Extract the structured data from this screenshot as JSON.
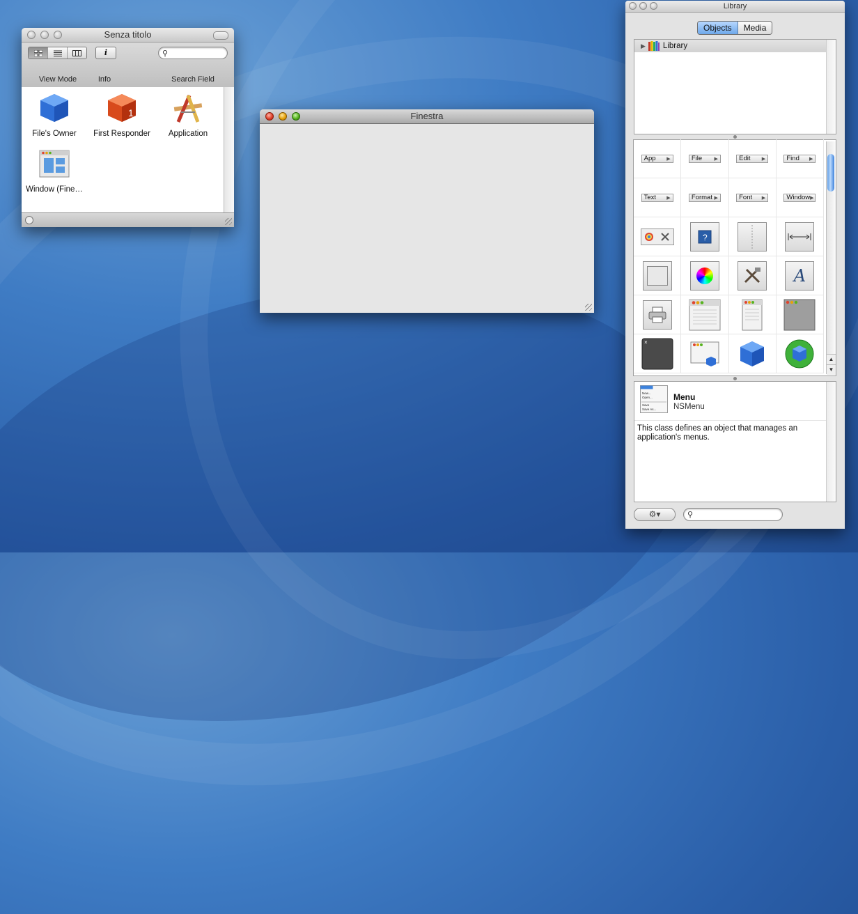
{
  "doc_window": {
    "title": "Senza titolo",
    "toolbar": {
      "view_mode_label": "View Mode",
      "info_label": "Info",
      "info_glyph": "i",
      "search_label": "Search Field",
      "search_value": ""
    },
    "items": [
      {
        "label": "File's Owner",
        "icon": "blue-cube-icon"
      },
      {
        "label": "First Responder",
        "icon": "red-cube-icon"
      },
      {
        "label": "Application",
        "icon": "application-icon"
      },
      {
        "label": "Window (Fine…",
        "icon": "window-icon"
      }
    ]
  },
  "finestra_window": {
    "title": "Finestra"
  },
  "library": {
    "title": "Library",
    "tabs": [
      "Objects",
      "Media"
    ],
    "selected_tab": "Objects",
    "tree_root": "Library",
    "menu_cells": [
      "App",
      "File",
      "Edit",
      "Find",
      "Text",
      "Format",
      "Font",
      "Window"
    ],
    "detail": {
      "name": "Menu",
      "class": "NSMenu",
      "description": "This class defines an object that manages an application's menus.",
      "thumb_items": [
        "New...",
        "Open...",
        "Save",
        "Save As..."
      ]
    },
    "search_value": ""
  },
  "colors": {
    "desktop": "#3f7cc4",
    "selected_tab": "#6ea8ea"
  }
}
